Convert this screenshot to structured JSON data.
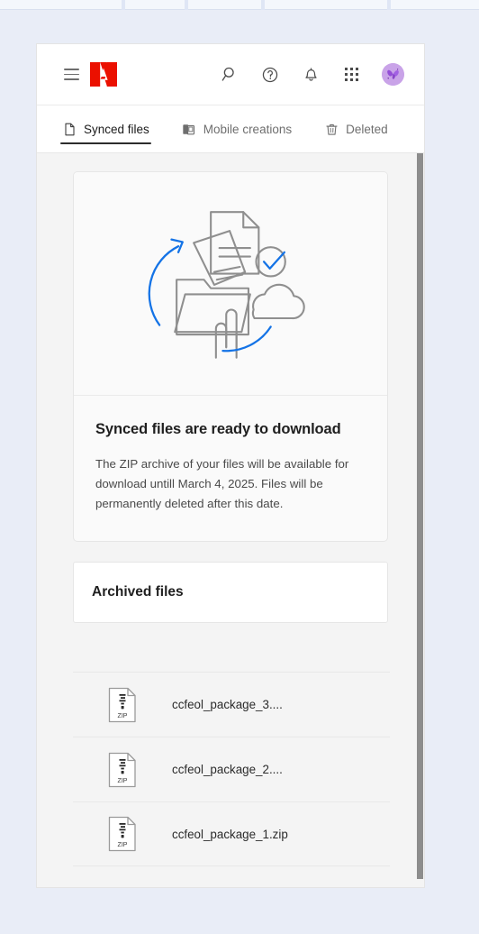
{
  "header": {
    "menu_icon": "hamburger-menu-icon",
    "logo": "adobe-logo",
    "icons": [
      {
        "name": "search-icon",
        "label": "Search"
      },
      {
        "name": "help-icon",
        "label": "Help"
      },
      {
        "name": "notifications-bell-icon",
        "label": "Notifications"
      },
      {
        "name": "app-switcher-grid-icon",
        "label": "Apps"
      }
    ],
    "avatar": {
      "name": "user-avatar",
      "label": "Account"
    }
  },
  "tabs": [
    {
      "label": "Synced files",
      "icon": "file-icon",
      "active": true
    },
    {
      "label": "Mobile creations",
      "icon": "mobile-devices-icon",
      "active": false
    },
    {
      "label": "Deleted",
      "icon": "trash-icon",
      "active": false
    }
  ],
  "hero": {
    "illustration": "sync-documents-cloud-illustration",
    "title": "Synced files are ready to download",
    "body": "The ZIP archive of your files will be available for download untill March 4, 2025. Files will be permanently deleted after this date."
  },
  "archived": {
    "title": "Archived files"
  },
  "files": [
    {
      "name": "ccfeol_package_3....",
      "type": "ZIP",
      "icon": "zip-file-icon"
    },
    {
      "name": "ccfeol_package_2....",
      "type": "ZIP",
      "icon": "zip-file-icon"
    },
    {
      "name": "ccfeol_package_1.zip",
      "type": "ZIP",
      "icon": "zip-file-icon"
    }
  ],
  "colors": {
    "page_background": "#e9edf7",
    "adobe_red": "#eb1000",
    "accent_blue": "#1473e6",
    "panel_background": "#f4f4f4",
    "text_primary": "#1f1f1f",
    "text_secondary": "#6e6e6e",
    "avatar_purple": "#c9a3e8",
    "scrollbar_thumb": "#8d8d8d"
  }
}
